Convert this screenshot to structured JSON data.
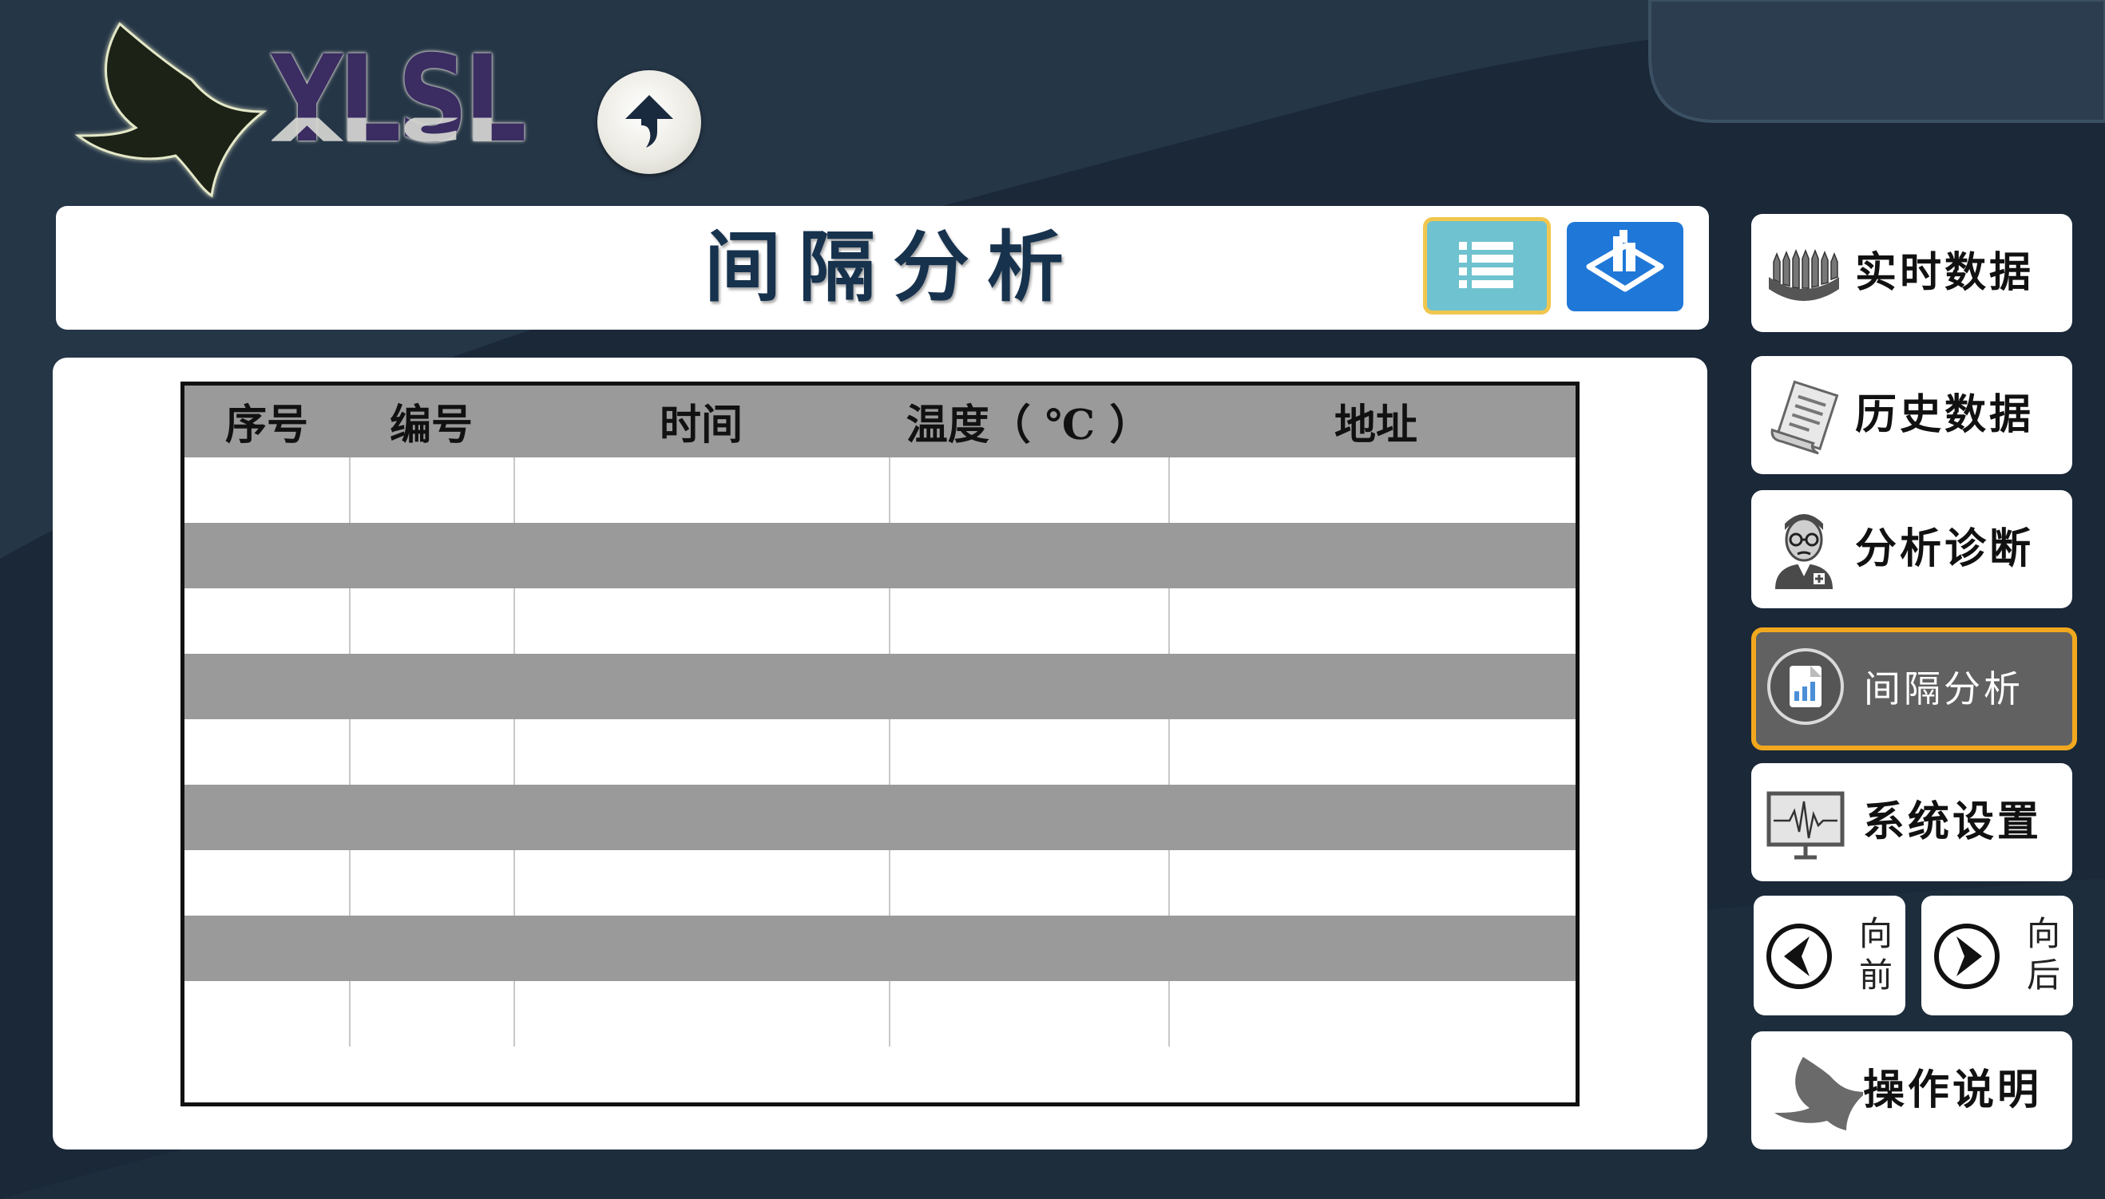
{
  "logo": {
    "text": "YLSL"
  },
  "header": {
    "title": "间隔分析"
  },
  "table": {
    "columns": [
      "序号",
      "编号",
      "时间",
      "温度（ ℃ ）",
      "地址"
    ],
    "rows": [
      [
        "",
        "",
        "",
        "",
        ""
      ],
      [
        "",
        "",
        "",
        "",
        ""
      ],
      [
        "",
        "",
        "",
        "",
        ""
      ],
      [
        "",
        "",
        "",
        "",
        ""
      ],
      [
        "",
        "",
        "",
        "",
        ""
      ],
      [
        "",
        "",
        "",
        "",
        ""
      ],
      [
        "",
        "",
        "",
        "",
        ""
      ],
      [
        "",
        "",
        "",
        "",
        ""
      ],
      [
        "",
        "",
        "",
        "",
        ""
      ]
    ]
  },
  "sidebar": {
    "items": [
      {
        "label": "实时数据",
        "icon": "pencils-icon"
      },
      {
        "label": "历史数据",
        "icon": "document-scroll-icon"
      },
      {
        "label": "分析诊断",
        "icon": "doctor-icon"
      },
      {
        "label": "间隔分析",
        "icon": "bar-chart-document-icon",
        "active": true
      },
      {
        "label": "系统设置",
        "icon": "monitor-waveform-icon"
      }
    ],
    "prev_label": "向前",
    "next_label": "向后",
    "help_label": "操作说明"
  },
  "colors": {
    "background": "#253647",
    "accent_active_border": "#f2a81e",
    "title_text": "#17324d",
    "list_view_button": "#6fc2cf",
    "view_3d_button": "#1f78d8"
  }
}
